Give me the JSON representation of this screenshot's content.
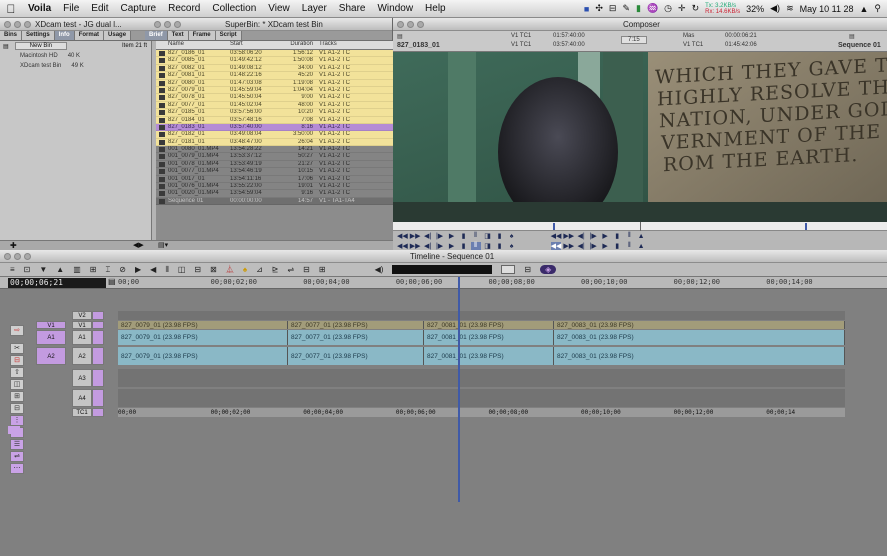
{
  "menubar": {
    "apple": "",
    "items": [
      "Voila",
      "File",
      "Edit",
      "Capture",
      "Record",
      "Collection",
      "View",
      "Layer",
      "Share",
      "Window",
      "Help"
    ],
    "net_tx": "Tx: 3.2KB/s",
    "net_rx": "Rx: 14.6KB/s",
    "battery": "32%",
    "clock": "May 10 11 28"
  },
  "browser": {
    "left_title": "XDcam test - JG dual l...",
    "title": "SuperBin: * XDcam test Bin",
    "proj_tabs": [
      "Bins",
      "Settings",
      "Info",
      "Format",
      "Usage"
    ],
    "bin_tabs": [
      "Brief",
      "Text",
      "Frame",
      "Script"
    ],
    "new_bin": "New Bin",
    "item_count": "Item 21 ft",
    "projects": [
      {
        "name": "Macintosh HD",
        "size": "40 K"
      },
      {
        "name": "XDcam test Bin",
        "size": "49 K"
      }
    ],
    "columns": [
      "Name",
      "Start",
      "Duration",
      "Tracks"
    ],
    "rows": [
      {
        "name": "827_0186_01",
        "start": "03:58:06:20",
        "dur": "1:56:12",
        "tracks": "V1 A1-2 TC",
        "st": "y"
      },
      {
        "name": "827_0085_01",
        "start": "01:49:42:12",
        "dur": "1:50:08",
        "tracks": "V1 A1-2 TC",
        "st": "y"
      },
      {
        "name": "827_0082_01",
        "start": "01:49:08:12",
        "dur": "34:00",
        "tracks": "V1 A1-2 TC",
        "st": "y"
      },
      {
        "name": "827_0081_01",
        "start": "01:48:22:16",
        "dur": "45:20",
        "tracks": "V1 A1-2 TC",
        "st": "y"
      },
      {
        "name": "827_0080_01",
        "start": "01:47:03:08",
        "dur": "1:19:08",
        "tracks": "V1 A1-2 TC",
        "st": "y"
      },
      {
        "name": "827_0079_01",
        "start": "01:45:59:04",
        "dur": "1:04:04",
        "tracks": "V1 A1-2 TC",
        "st": "y"
      },
      {
        "name": "827_0078_01",
        "start": "01:45:50:04",
        "dur": "9:00",
        "tracks": "V1 A1-2 TC",
        "st": "y"
      },
      {
        "name": "827_0077_01",
        "start": "01:45:02:04",
        "dur": "48:00",
        "tracks": "V1 A1-2 TC",
        "st": "y"
      },
      {
        "name": "827_0185_01",
        "start": "03:57:56:00",
        "dur": "10:20",
        "tracks": "V1 A1-2 TC",
        "st": "y"
      },
      {
        "name": "827_0184_01",
        "start": "03:57:48:16",
        "dur": "7:08",
        "tracks": "V1 A1-2 TC",
        "st": "y"
      },
      {
        "name": "827_0183_01",
        "start": "03:57:40:00",
        "dur": "8:16",
        "tracks": "V1 A1-2 TC",
        "st": "s"
      },
      {
        "name": "827_0182_01",
        "start": "03:49:08:04",
        "dur": "3:50:00",
        "tracks": "V1 A1-2 TC",
        "st": "y"
      },
      {
        "name": "827_0181_01",
        "start": "03:48:47:00",
        "dur": "26:04",
        "tracks": "V1 A1-2 TC",
        "st": "y"
      },
      {
        "name": "001_0080_01.MP4",
        "start": "13:54:28:22",
        "dur": "14:21",
        "tracks": "V1 A1-2 TC",
        "st": "g"
      },
      {
        "name": "001_0079_01.MP4",
        "start": "13:53:37:12",
        "dur": "50:27",
        "tracks": "V1 A1-2 TC",
        "st": "g"
      },
      {
        "name": "001_0078_01.MP4",
        "start": "13:53:49:19",
        "dur": "21:27",
        "tracks": "V1 A1-2 TC",
        "st": "g"
      },
      {
        "name": "001_0077_01.MP4",
        "start": "13:54:46:19",
        "dur": "10:15",
        "tracks": "V1 A1-2 TC",
        "st": "g"
      },
      {
        "name": "001_0017_01",
        "start": "13:54:11:16",
        "dur": "17:06",
        "tracks": "V1 A1-2 TC",
        "st": "g"
      },
      {
        "name": "001_0076_01.MP4",
        "start": "13:55:22:00",
        "dur": "19:01",
        "tracks": "V1 A1-2 TC",
        "st": "g"
      },
      {
        "name": "001_0020_01.MP4",
        "start": "13:54:59:04",
        "dur": "9:16",
        "tracks": "V1 A1-2 TC",
        "st": "g"
      },
      {
        "name": "Sequence 01",
        "start": "00:00:00:00",
        "dur": "14:57",
        "tracks": "V1 - TA1-TA4",
        "st": "d"
      }
    ]
  },
  "composer": {
    "title": "Composer",
    "left_tc1": "V1  TC1",
    "left_tc2": "V1  TC1",
    "left_val1": "01:57:40:00",
    "left_val2": "03:57:40:00",
    "left_clip": "827_0183_01",
    "mid_val": "7:15",
    "right_mas": "Mas",
    "right_tc": "V1  TC1",
    "right_val1": "00:00:06:21",
    "right_val2": "01:45:42:06",
    "right_clip": "Sequence 01",
    "overlay_text": [
      "WHICH THEY GAVE THE",
      "HIGHLY RESOLVE THAT TH",
      "NATION, UNDER GOD, SHALL",
      "VERNMENT OF THE PEOPLE",
      "ROM THE EARTH."
    ],
    "left_buttons": [
      "◀◀",
      "▶▶",
      "◀|",
      "|▶",
      "▶",
      "▮",
      "⦀",
      "◨",
      "▮",
      "♠"
    ],
    "right_buttons": [
      "◀◀",
      "▶▶",
      "◀|",
      "|▶",
      "▶",
      "▮",
      "⦀",
      "▲"
    ]
  },
  "timeline": {
    "title": "Timeline - Sequence 01",
    "tc": "00;00;06;21",
    "ticks": [
      "00;00",
      "00;00;02;00",
      "00;00;04;00",
      "00;00;06;00",
      "00;00;08;00",
      "00;00;10;00",
      "00;00;12;00",
      "00;00;14;00"
    ],
    "tracks": [
      {
        "label": "V2",
        "kind": "empty"
      },
      {
        "label": "V1",
        "kind": "video"
      },
      {
        "label": "A1",
        "kind": "audio"
      },
      {
        "label": "A2",
        "kind": "audio"
      },
      {
        "label": "A3",
        "kind": "empty"
      },
      {
        "label": "A4",
        "kind": "empty"
      },
      {
        "label": "TC1",
        "kind": "tc"
      }
    ],
    "src_tracks": [
      "V1",
      "A1",
      "A2"
    ],
    "clips_v1": [
      {
        "name": "827_0079_01 (23.98 FPS)",
        "w": 170
      },
      {
        "name": "827_0077_01 (23.98 FPS)",
        "w": 136
      },
      {
        "name": "827_0081_01 (23.98 FPS)",
        "w": 130
      },
      {
        "name": "827_0083_01 (23.98 FPS)",
        "w": 291
      }
    ],
    "clips_a": [
      {
        "name": "827_0079_01 (23.98 FPS)",
        "w": 170
      },
      {
        "name": "827_0077_01 (23.98 FPS)",
        "w": 136
      },
      {
        "name": "827_0081_01 (23.98 FPS)",
        "w": 130
      },
      {
        "name": "827_0083_01 (23.98 FPS)",
        "w": 291
      }
    ],
    "tc_track": [
      "00;00",
      "00;00;02;00",
      "00;00;04;00",
      "00;00;06;00",
      "00;00;08;00",
      "00;00;10;00",
      "00;00;12;00",
      "00;00;14"
    ],
    "playhead_fraction": 0.468
  }
}
